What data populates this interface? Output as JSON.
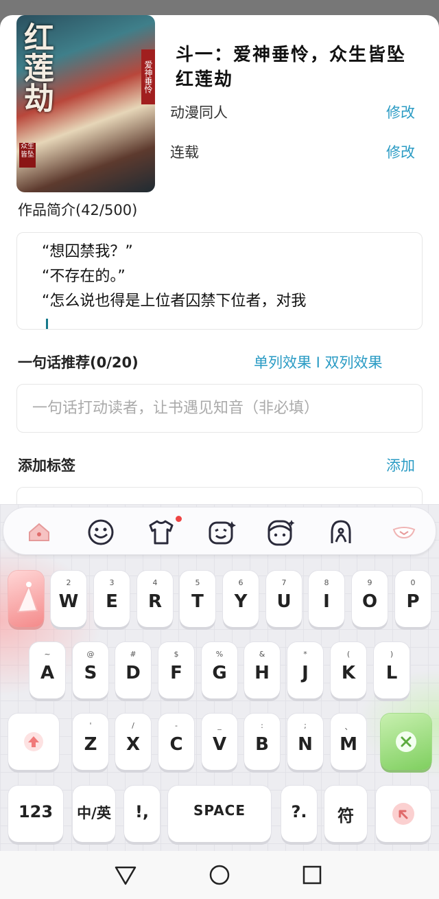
{
  "book": {
    "title": "斗一：爱神垂怜，众生皆坠红莲劫",
    "cover_text_main": "红莲劫",
    "cover_text_side": "爱神垂怜",
    "cover_text_small": "众生皆坠",
    "category_label": "动漫同人",
    "category_action": "修改",
    "status_label": "连载",
    "status_action": "修改"
  },
  "synopsis": {
    "heading": "作品简介(42/500)",
    "lines": [
      "“想囚禁我？”",
      "“不存在的。”",
      "“怎么说也得是上位者囚禁下位者，对我"
    ]
  },
  "recommend": {
    "heading": "一句话推荐(0/20)",
    "action": "单列效果 I 双列效果",
    "placeholder": "一句话打动读者，让书遇见知音（非必填）"
  },
  "tags": {
    "heading": "添加标签",
    "action": "添加"
  },
  "keyboard": {
    "row1": [
      {
        "main": "W",
        "sub": "2"
      },
      {
        "main": "E",
        "sub": "3"
      },
      {
        "main": "R",
        "sub": "4"
      },
      {
        "main": "T",
        "sub": "5"
      },
      {
        "main": "Y",
        "sub": "6"
      },
      {
        "main": "U",
        "sub": "7"
      },
      {
        "main": "I",
        "sub": "8"
      },
      {
        "main": "O",
        "sub": "9"
      },
      {
        "main": "P",
        "sub": "0"
      }
    ],
    "row2": [
      {
        "main": "A",
        "sub": "~"
      },
      {
        "main": "S",
        "sub": "@"
      },
      {
        "main": "D",
        "sub": "#"
      },
      {
        "main": "F",
        "sub": "$"
      },
      {
        "main": "G",
        "sub": "%"
      },
      {
        "main": "H",
        "sub": "&"
      },
      {
        "main": "J",
        "sub": "*"
      },
      {
        "main": "K",
        "sub": "("
      },
      {
        "main": "L",
        "sub": ")"
      }
    ],
    "row3": [
      {
        "main": "Z",
        "sub": "'"
      },
      {
        "main": "X",
        "sub": "/"
      },
      {
        "main": "C",
        "sub": "-"
      },
      {
        "main": "V",
        "sub": "_"
      },
      {
        "main": "B",
        "sub": ":"
      },
      {
        "main": "N",
        "sub": ";"
      },
      {
        "main": "M",
        "sub": "、"
      }
    ],
    "num_label": "123",
    "lang_label": "中/英",
    "punct_label": "!,",
    "space_label": "SPACE",
    "question_label": "?.",
    "symbol_label": "符",
    "accent_pink": "#f48a8a",
    "accent_green": "#7fcf5f"
  },
  "icons": {
    "toolbar": [
      "home-icon",
      "emoji-icon",
      "clothing-skin-icon",
      "sticker-face-icon",
      "avatar-icon",
      "handwriting-icon",
      "collapse-icon"
    ],
    "navbar": [
      "back-icon",
      "home-icon",
      "recents-icon"
    ]
  }
}
